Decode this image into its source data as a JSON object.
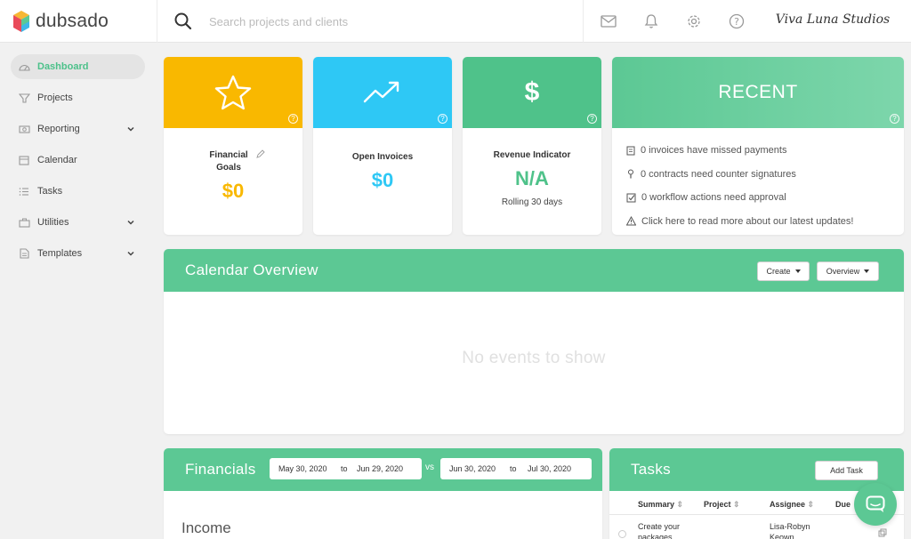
{
  "app": {
    "name": "dubsado",
    "studio_name": "Viva Luna Studios"
  },
  "search": {
    "placeholder": "Search projects and clients"
  },
  "top_icons": [
    "mail-icon",
    "bell-icon",
    "gear-icon",
    "help-icon"
  ],
  "sidebar": {
    "items": [
      {
        "label": "Dashboard",
        "icon": "dashboard-icon",
        "active": true
      },
      {
        "label": "Projects",
        "icon": "projects-icon"
      },
      {
        "label": "Reporting",
        "icon": "reporting-icon",
        "expandable": true
      },
      {
        "label": "Calendar",
        "icon": "calendar-icon"
      },
      {
        "label": "Tasks",
        "icon": "tasks-icon"
      },
      {
        "label": "Utilities",
        "icon": "utilities-icon",
        "expandable": true
      },
      {
        "label": "Templates",
        "icon": "templates-icon",
        "expandable": true
      }
    ]
  },
  "stats": {
    "financial_goals": {
      "label": "Financial Goals",
      "value": "$0",
      "color": "#f9b800",
      "icon": "star-icon"
    },
    "open_invoices": {
      "label": "Open Invoices",
      "value": "$0",
      "color": "#2ec8f5",
      "icon": "trending-up-icon"
    },
    "revenue_indicator": {
      "label": "Revenue Indicator",
      "value": "N/A",
      "sub": "Rolling 30 days",
      "color": "#4fc28a",
      "icon": "dollar-icon"
    }
  },
  "recent": {
    "title": "RECENT",
    "items": [
      {
        "text": "0 invoices have missed payments",
        "icon": "invoice-icon"
      },
      {
        "text": "0 contracts need counter signatures",
        "icon": "pen-nib-icon"
      },
      {
        "text": "0 workflow actions need approval",
        "icon": "checkbox-icon"
      },
      {
        "text": "Click here to read more about our latest updates!",
        "icon": "warning-icon"
      }
    ]
  },
  "calendar": {
    "title": "Calendar Overview",
    "create_label": "Create",
    "overview_label": "Overview",
    "empty_text": "No events to show"
  },
  "financials": {
    "title": "Financials",
    "range1": {
      "from": "May 30, 2020",
      "to_label": "to",
      "to": "Jun 29, 2020"
    },
    "vs_label": "vs",
    "range2": {
      "from": "Jun 30, 2020",
      "to_label": "to",
      "to": "Jul 30, 2020"
    },
    "income_label": "Income"
  },
  "tasks": {
    "title": "Tasks",
    "add_label": "Add Task",
    "columns": [
      "Summary",
      "Project",
      "Assignee",
      "Due"
    ],
    "rows": [
      {
        "summary_line1": "Create your",
        "summary_line2": "packages",
        "project": "",
        "assignee_line1": "Lisa-Robyn",
        "assignee_line2": "Keown",
        "due": ""
      }
    ]
  },
  "colors": {
    "accent_green": "#5cc894",
    "yellow": "#f9b800",
    "blue": "#2ec8f5",
    "green": "#4fc28a"
  }
}
